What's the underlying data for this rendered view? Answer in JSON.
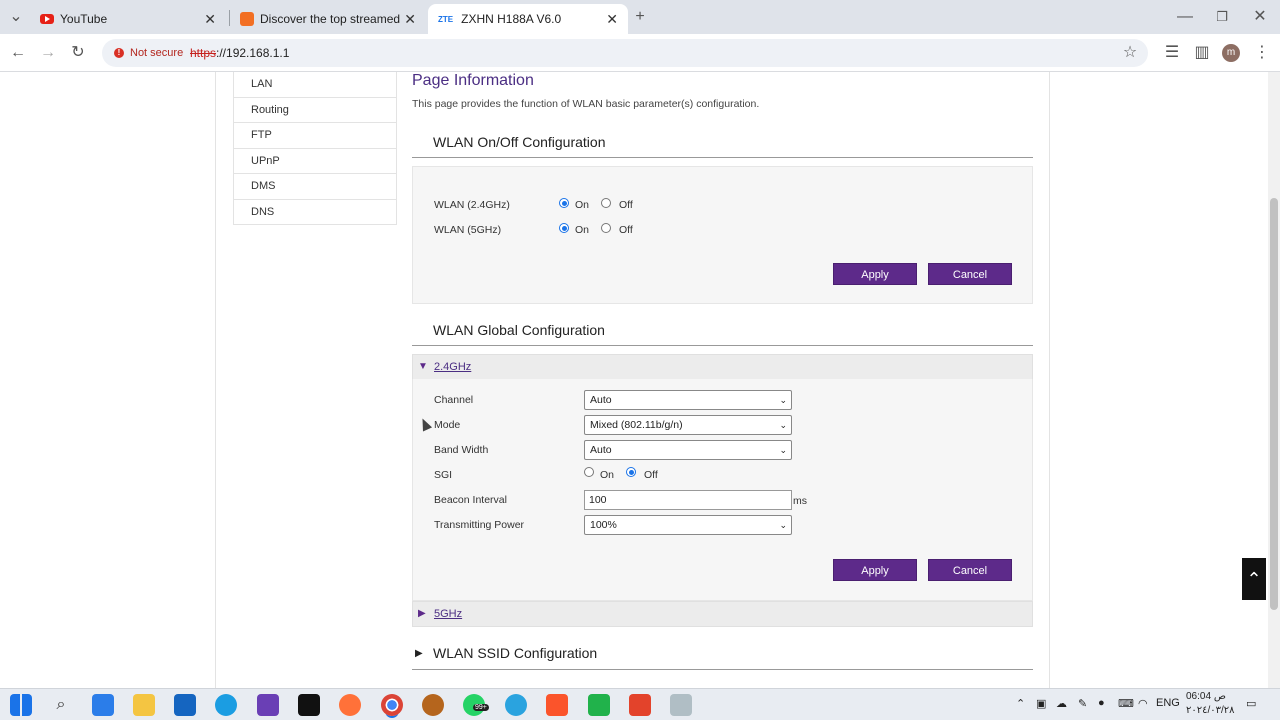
{
  "browser": {
    "tabs": [
      {
        "title": "YouTube",
        "icon": "youtube-icon"
      },
      {
        "title": "Discover the top streamed mus",
        "icon": "soundcloud-icon"
      },
      {
        "title": "ZXHN H188A V6.0",
        "icon": "zte-icon",
        "icon_text": "ZTE"
      }
    ],
    "security_label": "Not secure",
    "url_scheme": "https",
    "url_rest": "://192.168.1.1",
    "profile_initial": "m"
  },
  "sidebar": {
    "items": [
      "LAN",
      "Routing",
      "FTP",
      "UPnP",
      "DMS",
      "DNS"
    ]
  },
  "page": {
    "title": "Page Information",
    "description": "This page provides the function of WLAN basic parameter(s) configuration."
  },
  "onoff": {
    "title": "WLAN On/Off Configuration",
    "rows": [
      {
        "label": "WLAN (2.4GHz)",
        "on": "On",
        "off": "Off",
        "selected": "On"
      },
      {
        "label": "WLAN (5GHz)",
        "on": "On",
        "off": "Off",
        "selected": "On"
      }
    ],
    "apply": "Apply",
    "cancel": "Cancel"
  },
  "global": {
    "title": "WLAN Global Configuration",
    "band24": "2.4GHz",
    "fields": {
      "channel_label": "Channel",
      "channel_value": "Auto",
      "mode_label": "Mode",
      "mode_value": "Mixed (802.11b/g/n)",
      "bandwidth_label": "Band Width",
      "bandwidth_value": "Auto",
      "sgi_label": "SGI",
      "sgi_on": "On",
      "sgi_off": "Off",
      "sgi_selected": "Off",
      "beacon_label": "Beacon Interval",
      "beacon_value": "100",
      "beacon_unit": "ms",
      "power_label": "Transmitting Power",
      "power_value": "100%"
    },
    "apply": "Apply",
    "cancel": "Cancel",
    "band5": "5GHz"
  },
  "ssid": {
    "title": "WLAN SSID Configuration"
  },
  "taskbar": {
    "lang": "ENG",
    "time": "06:04 ص",
    "date": "٢٠٢٤/٠٣/٢٨",
    "badge": "99+"
  }
}
